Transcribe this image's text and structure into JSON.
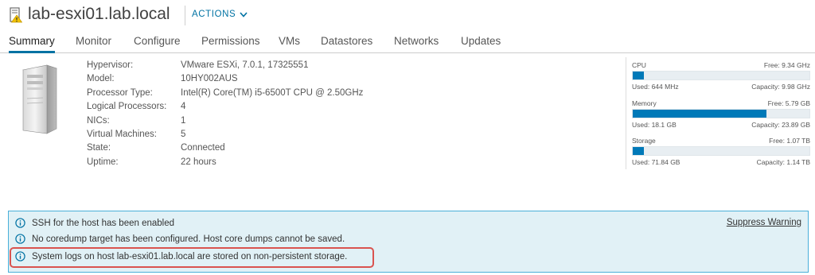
{
  "header": {
    "title": "lab-esxi01.lab.local",
    "actions_label": "ACTIONS",
    "host_icon": "host-warning-icon",
    "actions_icon": "chevron-down-icon"
  },
  "tabs": [
    {
      "label": "Summary",
      "active": true
    },
    {
      "label": "Monitor"
    },
    {
      "label": "Configure"
    },
    {
      "label": "Permissions"
    },
    {
      "label": "VMs"
    },
    {
      "label": "Datastores"
    },
    {
      "label": "Networks"
    },
    {
      "label": "Updates"
    }
  ],
  "properties": [
    {
      "label": "Hypervisor:",
      "value": "VMware ESXi, 7.0.1, 17325551"
    },
    {
      "label": "Model:",
      "value": "10HY002AUS"
    },
    {
      "label": "Processor Type:",
      "value": "Intel(R) Core(TM) i5-6500T CPU @ 2.50GHz"
    },
    {
      "label": "Logical Processors:",
      "value": "4"
    },
    {
      "label": "NICs:",
      "value": "1"
    },
    {
      "label": "Virtual Machines:",
      "value": "5"
    },
    {
      "label": "State:",
      "value": "Connected"
    },
    {
      "label": "Uptime:",
      "value": "22 hours"
    }
  ],
  "resources": {
    "cpu": {
      "name": "CPU",
      "free": "Free: 9.34 GHz",
      "used": "Used: 644 MHz",
      "capacity": "Capacity: 9.98 GHz",
      "used_fraction": 0.065
    },
    "memory": {
      "name": "Memory",
      "free": "Free: 5.79 GB",
      "used": "Used: 18.1 GB",
      "capacity": "Capacity: 23.89 GB",
      "used_fraction": 0.758
    },
    "storage": {
      "name": "Storage",
      "free": "Free: 1.07 TB",
      "used": "Used: 71.84 GB",
      "capacity": "Capacity: 1.14 TB",
      "used_fraction": 0.062
    }
  },
  "alerts": {
    "messages": [
      "SSH for the host has been enabled",
      "No coredump target has been configured. Host core dumps cannot be saved.",
      "System logs on host lab-esxi01.lab.local are stored on non-persistent storage."
    ],
    "suppress_label": "Suppress Warning",
    "icon": "info-icon"
  },
  "colors": {
    "accent": "#0072a3",
    "bar_fill": "#0079b8",
    "alert_bg": "#e1f1f6",
    "alert_border": "#49afd9",
    "highlight": "#d9534f"
  }
}
